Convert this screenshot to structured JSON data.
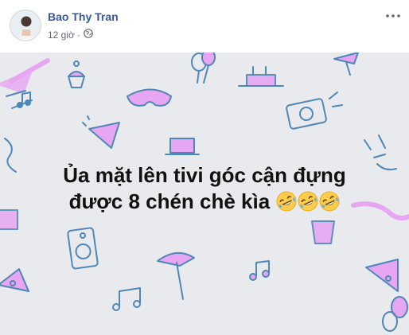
{
  "post": {
    "author": "Bao Thy Tran",
    "time": "12 giờ",
    "privacy_icon": "globe-icon",
    "more_icon": "more-options-icon",
    "text_line1": "Ủa mặt lên tivi góc cận đựng",
    "text_line2": "được 8 chén chè kìa",
    "emojis": [
      "rolling-on-floor-laughing",
      "rolling-on-floor-laughing",
      "rolling-on-floor-laughing"
    ],
    "background": "party-doodles",
    "colors": {
      "author": "#385898",
      "meta": "#616770",
      "background": "#e8eaed",
      "doodle_stroke": "#4f87b6",
      "doodle_accent": "#e6a6f2",
      "text": "#111111"
    }
  }
}
